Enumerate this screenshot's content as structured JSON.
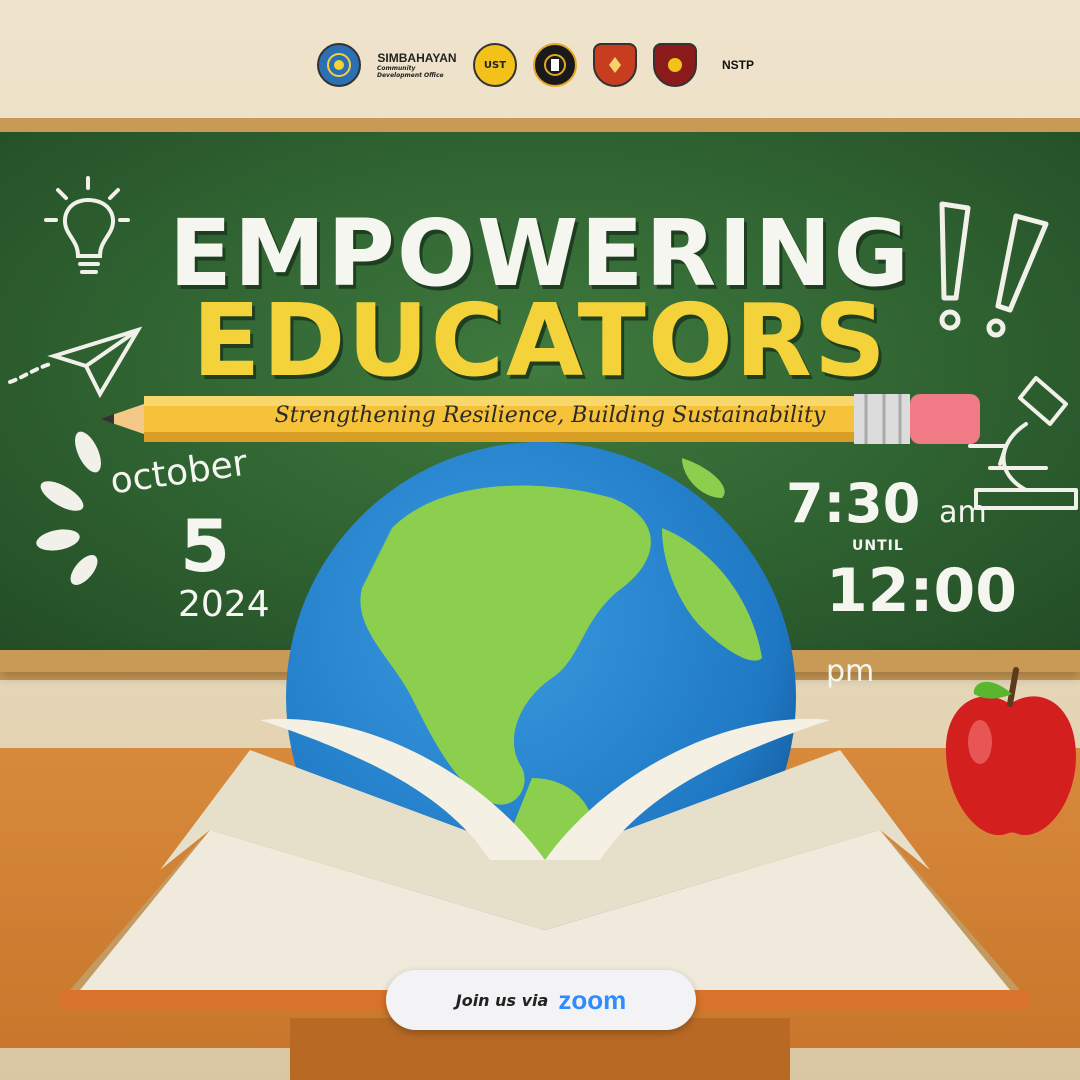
{
  "logos": [
    {
      "name": "plm-seal",
      "text": ""
    },
    {
      "name": "simbahayan",
      "text": "SIMBAHAYAN",
      "sub": "Community Development Office"
    },
    {
      "name": "ust-shs",
      "text": "UST"
    },
    {
      "name": "college-seal",
      "text": ""
    },
    {
      "name": "shield-orange",
      "text": ""
    },
    {
      "name": "shield-red",
      "text": ""
    },
    {
      "name": "nstp",
      "text": "NSTP"
    }
  ],
  "title": {
    "line1": "EMPOWERING",
    "line2": "EDUCATORS",
    "tagline": "Strengthening Resilience, Building Sustainability"
  },
  "date": {
    "month": "october",
    "day": "5",
    "year": "2024"
  },
  "time": {
    "start": "7:30",
    "start_suffix": "am",
    "until": "UNTIL",
    "end": "12:00",
    "end_suffix": "pm"
  },
  "cta": {
    "text": "Join us via",
    "platform": "zoom"
  },
  "colors": {
    "board": "#2f6231",
    "title_white": "#f6f6f0",
    "title_yellow": "#f4d23a",
    "zoom_blue": "#2d8cff"
  }
}
